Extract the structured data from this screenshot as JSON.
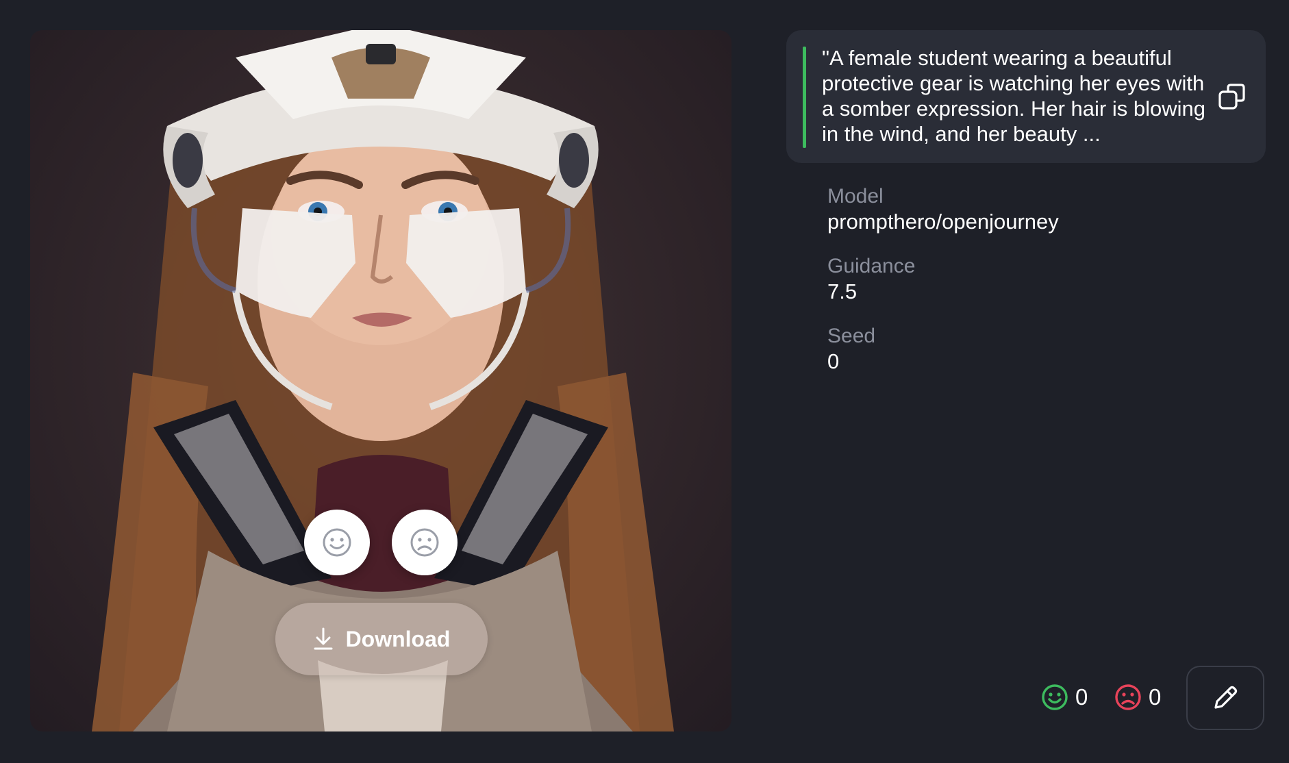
{
  "image": {
    "alt": "Portrait of a young woman wearing white protective gear helmet with face plates",
    "reactions": {
      "like_icon": "smiley-icon",
      "dislike_icon": "frown-icon"
    },
    "download_label": "Download"
  },
  "prompt": {
    "text": "\"A female student wearing a beautiful protective gear is watching her eyes with a somber expression. Her hair is blowing in the wind, and her beauty ...",
    "accent_color": "#3dbb5e"
  },
  "meta": {
    "model_label": "Model",
    "model_value": "prompthero/openjourney",
    "guidance_label": "Guidance",
    "guidance_value": "7.5",
    "seed_label": "Seed",
    "seed_value": "0"
  },
  "stats": {
    "likes": "0",
    "dislikes": "0",
    "like_color": "#3dbb5e",
    "dislike_color": "#e8435a"
  },
  "colors": {
    "background": "#1e2028",
    "card": "#2a2d37",
    "muted_text": "#8b8f9c"
  }
}
